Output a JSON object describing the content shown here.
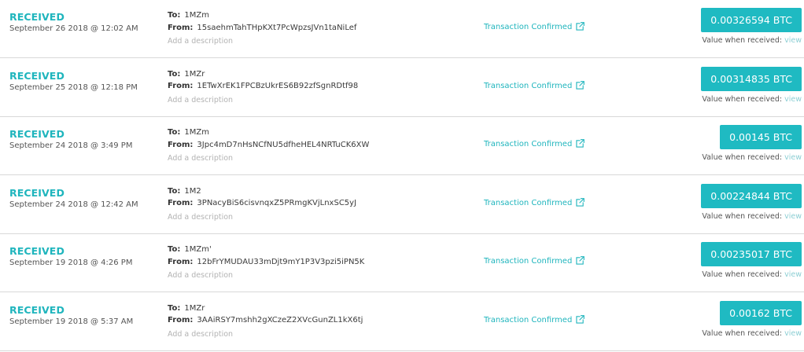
{
  "transactions": [
    {
      "status": "RECEIVED",
      "date": "September 26 2018 @ 12:02 AM",
      "to_label": "To:",
      "to": "1MZm",
      "from_label": "From:",
      "from": "15saehmTahTHpKXt7PcWpzsJVn1taNiLef",
      "description_placeholder": "Add a description",
      "confirmation": "Transaction Confirmed",
      "amount": "0.00326594 BTC",
      "value_label": "Value when received:",
      "view_label": "view"
    },
    {
      "status": "RECEIVED",
      "date": "September 25 2018 @ 12:18 PM",
      "to_label": "To:",
      "to": "1MZr",
      "from_label": "From:",
      "from": "1ETwXrEK1FPCBzUkrES6B92zfSgnRDtf98",
      "description_placeholder": "Add a description",
      "confirmation": "Transaction Confirmed",
      "amount": "0.00314835 BTC",
      "value_label": "Value when received:",
      "view_label": "view"
    },
    {
      "status": "RECEIVED",
      "date": "September 24 2018 @ 3:49 PM",
      "to_label": "To:",
      "to": "1MZm",
      "from_label": "From:",
      "from": "3Jpc4mD7nHsNCfNU5dfheHEL4NRTuCK6XW",
      "description_placeholder": "Add a description",
      "confirmation": "Transaction Confirmed",
      "amount": "0.00145 BTC",
      "value_label": "Value when received:",
      "view_label": "view"
    },
    {
      "status": "RECEIVED",
      "date": "September 24 2018 @ 12:42 AM",
      "to_label": "To:",
      "to": "1M2",
      "from_label": "From:",
      "from": "3PNacyBiS6cisvnqxZ5PRmgKVjLnxSC5yJ",
      "description_placeholder": "Add a description",
      "confirmation": "Transaction Confirmed",
      "amount": "0.00224844 BTC",
      "value_label": "Value when received:",
      "view_label": "view"
    },
    {
      "status": "RECEIVED",
      "date": "September 19 2018 @ 4:26 PM",
      "to_label": "To:",
      "to": "1MZm'",
      "from_label": "From:",
      "from": "12bFrYMUDAU33mDjt9mY1P3V3pzi5iPN5K",
      "description_placeholder": "Add a description",
      "confirmation": "Transaction Confirmed",
      "amount": "0.00235017 BTC",
      "value_label": "Value when received:",
      "view_label": "view"
    },
    {
      "status": "RECEIVED",
      "date": "September 19 2018 @ 5:37 AM",
      "to_label": "To:",
      "to": "1MZr",
      "from_label": "From:",
      "from": "3AAiRSY7mshh2gXCzeZ2XVcGunZL1kX6tj",
      "description_placeholder": "Add a description",
      "confirmation": "Transaction Confirmed",
      "amount": "0.00162 BTC",
      "value_label": "Value when received:",
      "view_label": "view"
    }
  ],
  "colors": {
    "accent": "#1fb5bd",
    "amount_button": "#1fbac2",
    "muted_text": "#b3b3b3",
    "divider": "#d8d8d8"
  },
  "icons": {
    "confirmation": "external-link-icon"
  }
}
